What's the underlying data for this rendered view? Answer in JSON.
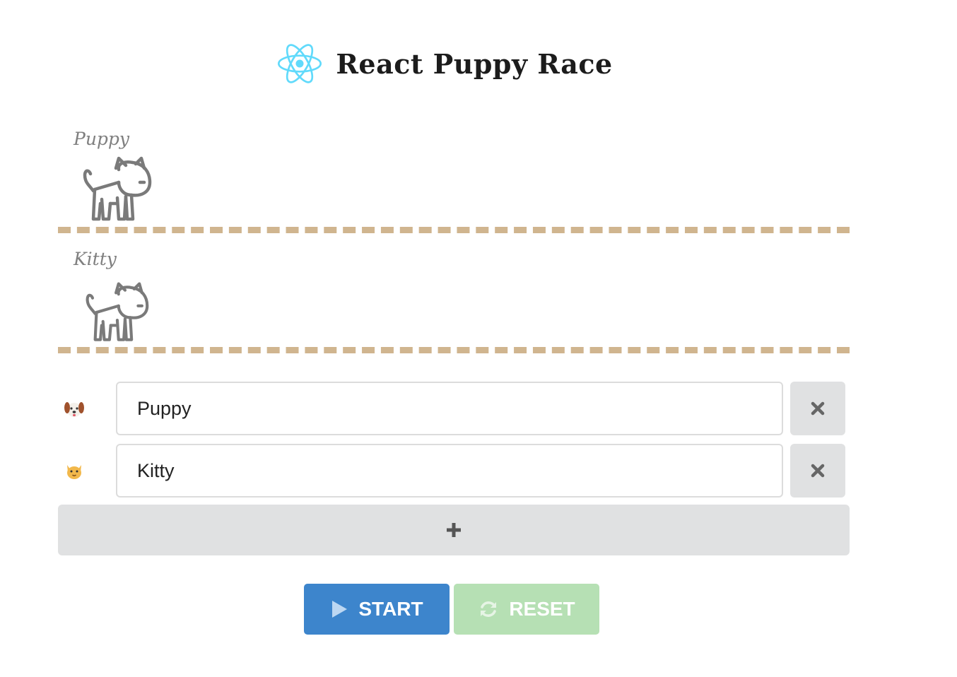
{
  "header": {
    "title": "React Puppy Race",
    "logo_icon": "react-logo-icon",
    "logo_color": "#61dafb"
  },
  "race": {
    "lanes": [
      {
        "label": "Puppy",
        "runner_icon": "pet-outline-icon"
      },
      {
        "label": "Kitty",
        "runner_icon": "pet-outline-icon"
      }
    ],
    "track_color": "#d0b58f"
  },
  "entries": [
    {
      "emoji_icon": "dog-face-icon",
      "value": "Puppy",
      "remove_icon": "close-icon"
    },
    {
      "emoji_icon": "cat-face-icon",
      "value": "Kitty",
      "remove_icon": "close-icon"
    }
  ],
  "add_button": {
    "icon": "plus-icon"
  },
  "controls": {
    "start_label": "START",
    "start_icon": "play-icon",
    "start_color": "#3d85cc",
    "reset_label": "RESET",
    "reset_icon": "refresh-icon",
    "reset_color": "#b6e0b4",
    "reset_disabled": true
  }
}
